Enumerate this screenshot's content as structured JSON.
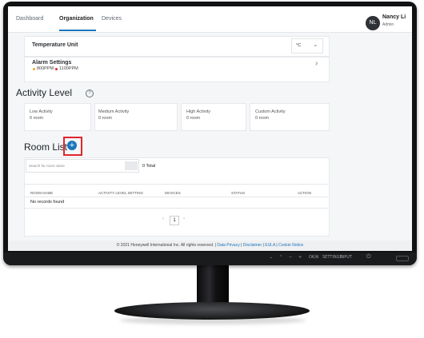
{
  "nav": {
    "tabs": [
      "Dashboard",
      "Organization",
      "Devices"
    ],
    "avatar_initials": "NL",
    "user_name": "Nancy Li",
    "user_role": "Admin"
  },
  "settings": {
    "temperature_unit_label": "Temperature Unit",
    "temperature_unit_value": "°C",
    "alarm_label": "Alarm Settings",
    "alarm_level_1": "800PPM",
    "alarm_level_2": "1100PPM",
    "alarm_colors": [
      "#f5a623",
      "#e0262c"
    ]
  },
  "activity": {
    "title": "Activity Level",
    "help_icon": "?",
    "cards": [
      {
        "label": "Low Activity",
        "value": "0 room"
      },
      {
        "label": "Medium Activity",
        "value": "0 room"
      },
      {
        "label": "High Activity",
        "value": "0 room"
      },
      {
        "label": "Custom Activity",
        "value": "0 room"
      }
    ]
  },
  "room_list": {
    "title": "Room List",
    "add_icon": "+",
    "search_placeholder": "Search for room name",
    "total": "0 Total",
    "columns": [
      "ROOM NAME",
      "ACTIVITY LEVEL SETTING",
      "DEVICES",
      "STATUS",
      "ACTION"
    ],
    "empty_text": "No records found",
    "page": "1",
    "prev_icon": "‹",
    "next_icon": "›"
  },
  "footer": {
    "copyright": "© 2021 Honeywell International Inc. All rights reserved.",
    "separator": "|",
    "links": [
      "Data Privacy",
      "Disclaimer",
      "EULA",
      "Cookie Notice"
    ]
  },
  "monitor": {
    "controls_symbols": [
      "⌄",
      "⌃",
      "−",
      "+"
    ],
    "controls_text": [
      "OK/ⅲ",
      "SETTINGS",
      "INPUT"
    ],
    "power_icon": "⏻"
  },
  "colors": {
    "accent": "#1b75bc",
    "highlight": "#e0262c"
  }
}
